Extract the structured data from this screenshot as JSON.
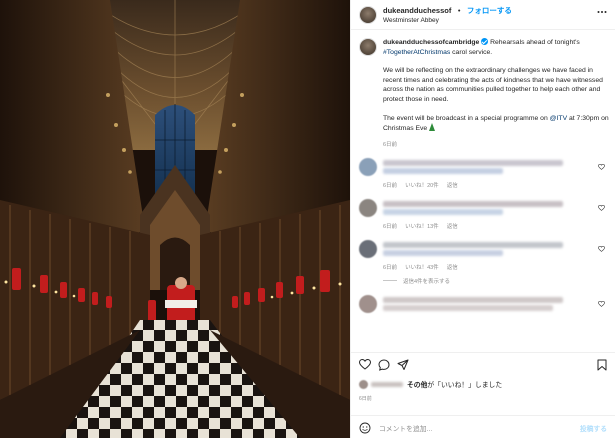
{
  "header": {
    "username": "dukeandduchessof",
    "separator": "•",
    "follow_label": "フォローする",
    "location": "Westminster Abbey"
  },
  "caption": {
    "username": "dukeandduchessofcambridge",
    "intro": "Rehearsals ahead of tonight's",
    "hashtag": "#TogetherAtChristmas",
    "intro_tail": " carol service.",
    "para2": "We will be reflecting on the extraordinary challenges we have faced in recent times and celebrating the acts of kindness that we have witnessed across the nation as communities pulled together to help each other and protect those in need.",
    "para3_pre": "The event will be broadcast in a special programme on ",
    "mention": "@ITV",
    "para3_post": " at 7:30pm on Christmas Eve ",
    "time_ago": "6日前"
  },
  "comments": [
    {
      "avatar_color": "#8aa0b8",
      "lines": [
        "#c9c6cf",
        "#c4cfe2"
      ],
      "time": "6日前",
      "likes": "いいね！20件",
      "reply": "返信"
    },
    {
      "avatar_color": "#8b8580",
      "lines": [
        "#c8c0c5",
        "#c7d4e5"
      ],
      "time": "6日前",
      "likes": "いいね！13件",
      "reply": "返信"
    },
    {
      "avatar_color": "#6a6f78",
      "lines": [
        "#c3c6cc",
        "#c7d0e2"
      ],
      "time": "6日前",
      "likes": "いいね！43件",
      "reply": "返信"
    },
    {
      "avatar_color": "#a0908c",
      "lines": [
        "#cfc8c8",
        "#d6cfcf"
      ],
      "time": "",
      "likes": "",
      "reply": ""
    }
  ],
  "replies_label": "返信4件を表示する",
  "likes_row": {
    "suffix_bold": "その他",
    "suffix": "が「いいね！」しました"
  },
  "post_date": "6日前",
  "add_comment": {
    "placeholder": "コメントを追加...",
    "post_label": "投稿する"
  },
  "icons": {
    "more": "more-icon",
    "like": "heart-icon",
    "comment": "comment-icon",
    "share": "share-icon",
    "save": "bookmark-icon",
    "emoji": "emoji-icon",
    "verified": "verified-icon"
  },
  "colors": {
    "follow": "#0095f6",
    "link": "#00376b",
    "secondary": "#8e8e8e"
  }
}
